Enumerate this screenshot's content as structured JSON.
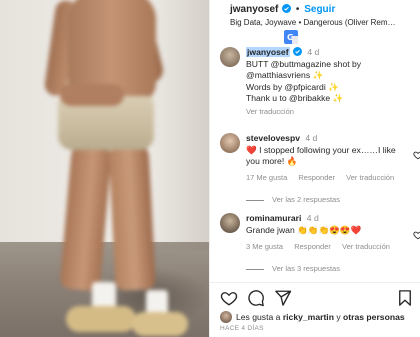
{
  "post": {
    "username": "jwanyosef",
    "separator": "•",
    "follow_label": "Seguir",
    "audio": "Big Data, Joywave • Dangerous (Oliver Rem…",
    "caption": {
      "username": "jwanyosef",
      "time": "4 d",
      "line1": "BUTT @buttmagazine shot by",
      "line2": "@matthiasvriens ✨",
      "line3": "Words by @pfpicardi ✨",
      "line4": "Thank u to @bribakke ✨",
      "translate_label": "Ver traducción"
    }
  },
  "comments": [
    {
      "username": "stevelovespv",
      "time": "4 d",
      "text": "❤️ I stopped following your ex……I like you more! 🔥",
      "likes": "17 Me gusta",
      "reply_label": "Responder",
      "translate_label": "Ver traducción",
      "view_replies": "Ver las 2 respuestas"
    },
    {
      "username": "rominamurari",
      "time": "4 d",
      "text": "Grande jwan 👏👏👏😍😍❤️",
      "likes": "3 Me gusta",
      "reply_label": "Responder",
      "translate_label": "Ver traducción",
      "view_replies": "Ver las 3 respuestas"
    }
  ],
  "likes_line": {
    "prefix": "Les gusta a",
    "user": "ricky_martin",
    "connector": "y",
    "others": "otras personas"
  },
  "date": "HACE 4 DÍAS",
  "icons": {
    "verified": "verified-badge-icon",
    "translate": "translate-icon",
    "heart": "heart-icon",
    "comment": "comment-icon",
    "share": "share-icon",
    "save": "bookmark-icon"
  },
  "colors": {
    "link_blue": "#0095f6",
    "mention": "#00376b",
    "muted": "#8e8e8e",
    "highlight": "#b3d7fe"
  }
}
